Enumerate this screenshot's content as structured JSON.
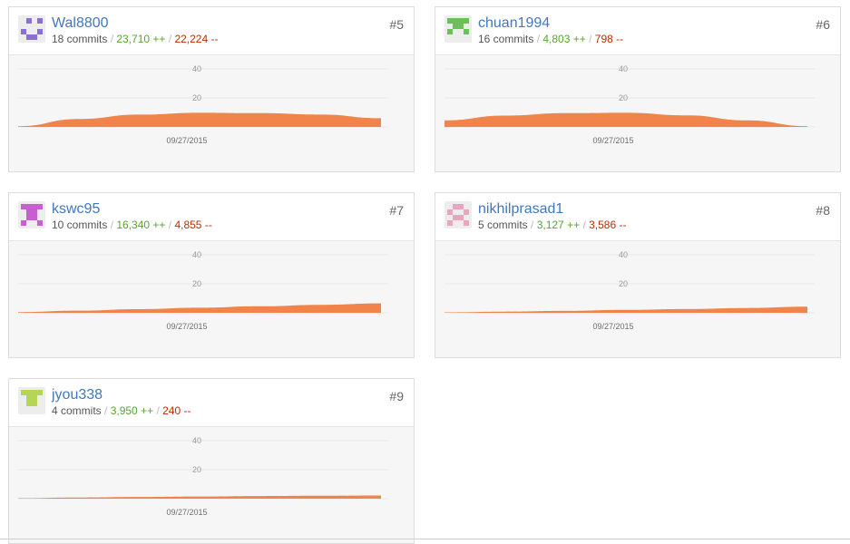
{
  "colors": {
    "area": "#f1844a",
    "link": "#4078c0",
    "additions": "#55a532",
    "deletions": "#bd2c00"
  },
  "contributors": [
    {
      "username": "Wal8800",
      "rank": "#5",
      "commits": "18 commits",
      "additions": "23,710 ++",
      "deletions": "22,224 --",
      "avatar_color": "#8c6fd2",
      "chart_data": {
        "type": "area",
        "y_ticks": [
          "40",
          "20"
        ],
        "x_label": "09/27/2015",
        "ylim": [
          0,
          50
        ],
        "values": [
          0.5,
          5.5,
          8.5,
          9.8,
          9.5,
          8.5,
          6.0
        ]
      }
    },
    {
      "username": "chuan1994",
      "rank": "#6",
      "commits": "16 commits",
      "additions": "4,803 ++",
      "deletions": "798 --",
      "avatar_color": "#6cc05a",
      "chart_data": {
        "type": "area",
        "y_ticks": [
          "40",
          "20"
        ],
        "x_label": "09/27/2015",
        "ylim": [
          0,
          50
        ],
        "values": [
          4.5,
          7.8,
          9.5,
          9.8,
          8.0,
          4.5,
          0.5
        ]
      }
    },
    {
      "username": "kswc95",
      "rank": "#7",
      "commits": "10 commits",
      "additions": "16,340 ++",
      "deletions": "4,855 --",
      "avatar_color": "#c95ed2",
      "chart_data": {
        "type": "area",
        "y_ticks": [
          "40",
          "20"
        ],
        "x_label": "09/27/2015",
        "ylim": [
          0,
          50
        ],
        "values": [
          0.5,
          1.5,
          2.5,
          3.5,
          4.5,
          5.5,
          6.5
        ]
      }
    },
    {
      "username": "nikhilprasad1",
      "rank": "#8",
      "commits": "5 commits",
      "additions": "3,127 ++",
      "deletions": "3,586 --",
      "avatar_color": "#e7a6be",
      "chart_data": {
        "type": "area",
        "y_ticks": [
          "40",
          "20"
        ],
        "x_label": "09/27/2015",
        "ylim": [
          0,
          50
        ],
        "values": [
          0.3,
          0.8,
          1.3,
          2.0,
          2.6,
          3.3,
          4.2
        ]
      }
    },
    {
      "username": "jyou338",
      "rank": "#9",
      "commits": "4 commits",
      "additions": "3,950 ++",
      "deletions": "240 --",
      "avatar_color": "#b4d654",
      "chart_data": {
        "type": "area",
        "y_ticks": [
          "40",
          "20"
        ],
        "x_label": "09/27/2015",
        "ylim": [
          0,
          50
        ],
        "values": [
          0.3,
          0.8,
          1.2,
          1.5,
          1.8,
          2.0,
          2.2
        ]
      }
    }
  ]
}
